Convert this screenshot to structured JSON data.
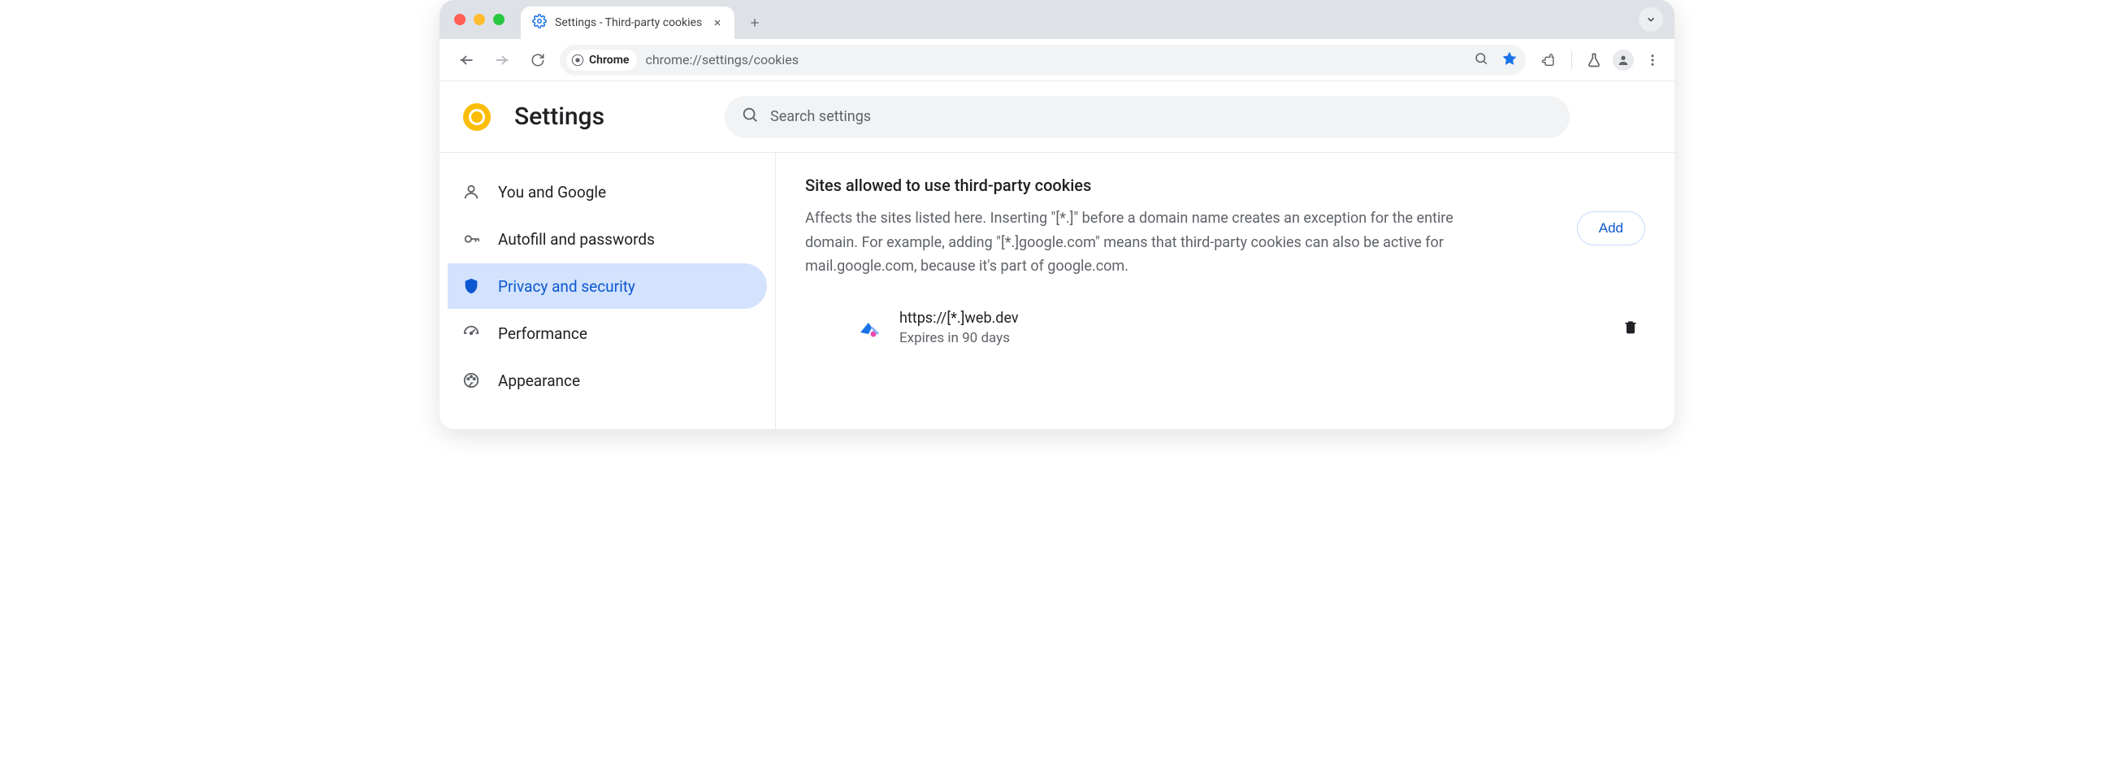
{
  "browser": {
    "tab_title": "Settings - Third-party cookies",
    "url": "chrome://settings/cookies",
    "chip_label": "Chrome"
  },
  "header": {
    "app_title": "Settings",
    "search_placeholder": "Search settings"
  },
  "sidebar": {
    "items": [
      {
        "label": "You and Google"
      },
      {
        "label": "Autofill and passwords"
      },
      {
        "label": "Privacy and security"
      },
      {
        "label": "Performance"
      },
      {
        "label": "Appearance"
      }
    ]
  },
  "section": {
    "title": "Sites allowed to use third-party cookies",
    "description": "Affects the sites listed here. Inserting \"[*.]\" before a domain name creates an exception for the entire domain. For example, adding \"[*.]google.com\" means that third-party cookies can also be active for mail.google.com, because it's part of google.com.",
    "add_label": "Add"
  },
  "sites": [
    {
      "url": "https://[*.]web.dev",
      "expires": "Expires in 90 days"
    }
  ]
}
